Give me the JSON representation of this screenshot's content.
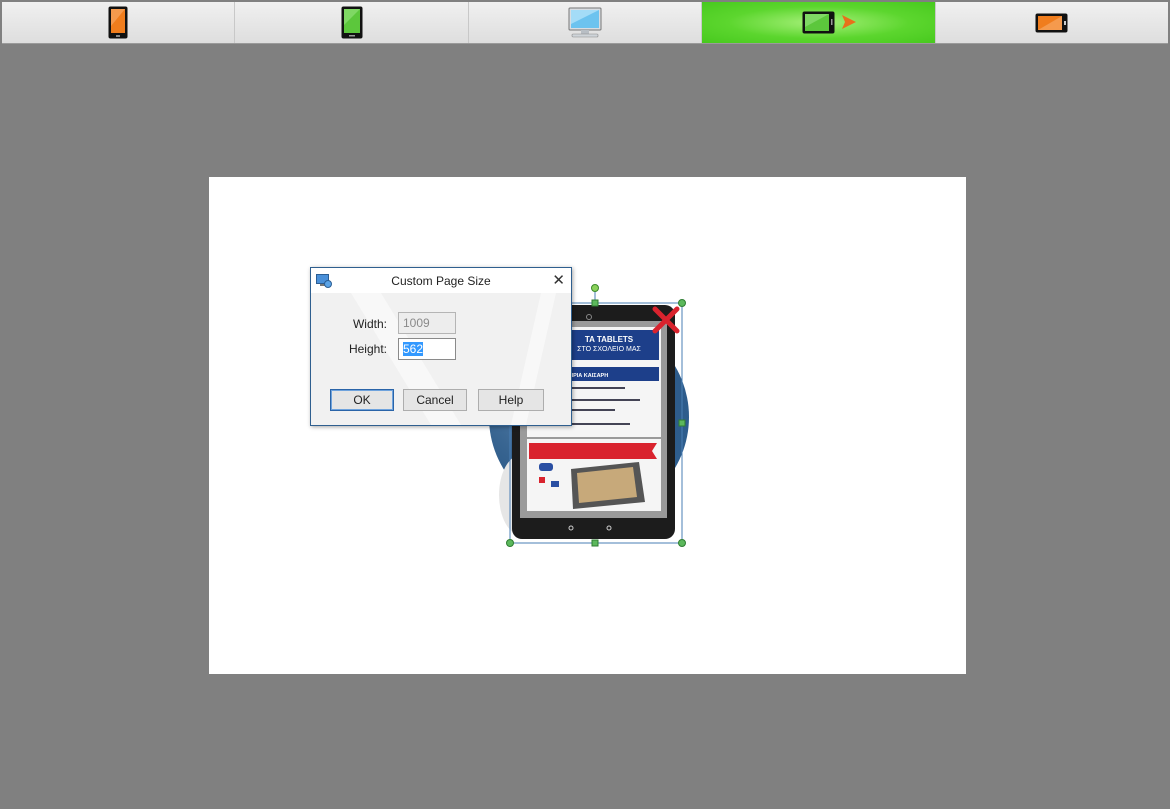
{
  "toolbar": {
    "tabs": [
      {
        "name": "phone-portrait",
        "icon": "phone-portrait-icon",
        "color": "#f07d1d",
        "active": false
      },
      {
        "name": "tablet-portrait",
        "icon": "tablet-portrait-icon",
        "color": "#5cc73c",
        "active": false
      },
      {
        "name": "desktop",
        "icon": "monitor-icon",
        "color": "#6cc3ef",
        "active": false
      },
      {
        "name": "tablet-landscape",
        "icon": "tablet-landscape-icon",
        "color": "#5cc73c",
        "active": true
      },
      {
        "name": "phone-landscape",
        "icon": "phone-landscape-icon",
        "color": "#f07d1d",
        "active": false
      }
    ],
    "active_color": "#5cd62e"
  },
  "canvas": {
    "background": "#ffffff",
    "graphic": {
      "banner_title": "TA TABLETS",
      "banner_subtitle": "ΣΤΟ ΣΧΟΛΕΙΟ ΜΑΣ",
      "section_title": "ΠΑΙΔΕΥΤΗΡΙΑ ΚΑΙΣΑΡΗ"
    }
  },
  "dialog": {
    "title": "Custom Page Size",
    "width_label": "Width:",
    "width_value": "1009",
    "height_label": "Height:",
    "height_value": "562",
    "ok_label": "OK",
    "cancel_label": "Cancel",
    "help_label": "Help"
  }
}
